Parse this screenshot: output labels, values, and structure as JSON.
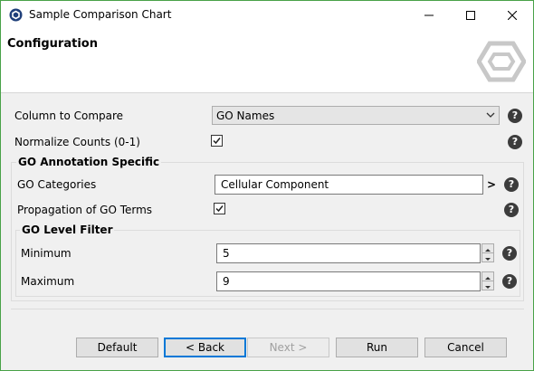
{
  "window": {
    "title": "Sample Comparison Chart"
  },
  "icons": {
    "app": "app-logo-icon",
    "minimize": "minimize-icon",
    "maximize": "maximize-icon",
    "close": "close-icon",
    "brand": "hexagon-logo-icon",
    "help": "help-icon",
    "checkmark": "checkmark-icon",
    "chevron": "chevron-right-icon"
  },
  "colors": {
    "accent": "#0078d7",
    "window_border": "#49a248",
    "logo": "#c8c8c8"
  },
  "header": {
    "title": "Configuration"
  },
  "form": {
    "column_to_compare": {
      "label": "Column to Compare",
      "value": "GO Names",
      "help": "?"
    },
    "normalize_counts": {
      "label": "Normalize Counts (0-1)",
      "checked": true,
      "help": "?"
    },
    "go_annotation": {
      "title": "GO Annotation Specific",
      "categories": {
        "label": "GO Categories",
        "value": "Cellular Component",
        "more": ">",
        "help": "?"
      },
      "propagation": {
        "label": "Propagation of GO Terms",
        "checked": true,
        "help": "?"
      },
      "level_filter": {
        "title": "GO Level Filter",
        "minimum": {
          "label": "Minimum",
          "value": "5",
          "help": "?"
        },
        "maximum": {
          "label": "Maximum",
          "value": "9",
          "help": "?"
        }
      }
    }
  },
  "buttons": {
    "default": "Default",
    "back": "< Back",
    "next": "Next >",
    "run": "Run",
    "cancel": "Cancel"
  }
}
